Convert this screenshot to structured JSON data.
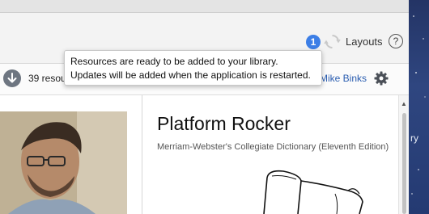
{
  "header": {
    "notification_count": "1",
    "layouts_label": "Layouts",
    "help_symbol": "?"
  },
  "tooltip": {
    "line1": "Resources are ready to be added to your library.",
    "line2": "Updates will be added when the application is restarted."
  },
  "toolbar": {
    "resources_text": "39 resources",
    "user_name": "Mike Binks"
  },
  "resource": {
    "title": "Platform Rocker",
    "source": "Merriam-Webster's Collegiate Dictionary (Eleventh Edition)"
  },
  "desktop": {
    "side_text": "ry"
  },
  "icons": {
    "sync": "sync-icon",
    "help": "help-icon",
    "download": "download-icon",
    "settings": "gear-icon",
    "scroll_up": "scroll-up-icon"
  },
  "colors": {
    "badge": "#3c7ee6",
    "link": "#2a5db0",
    "desktop": "#2b3f73"
  }
}
